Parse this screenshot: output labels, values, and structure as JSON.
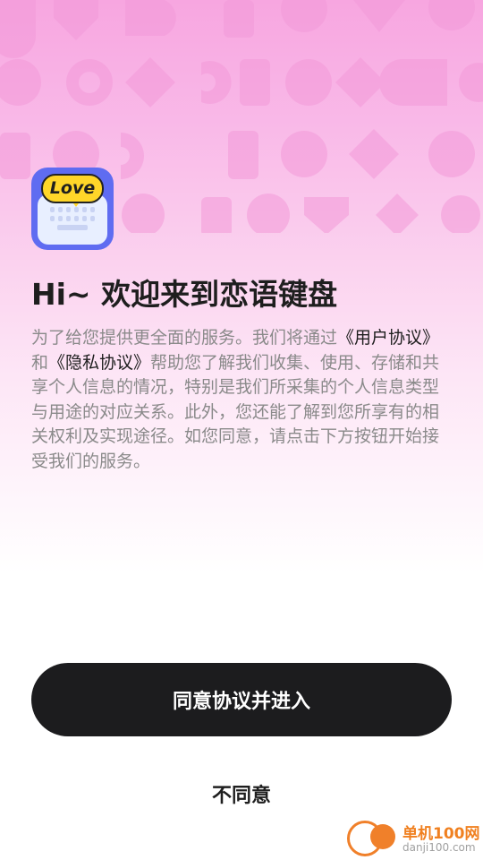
{
  "app_icon": {
    "bubble_text": "Love"
  },
  "title": "Hi~ 欢迎来到恋语键盘",
  "description": {
    "part1": "为了给您提供更全面的服务。我们将通过",
    "user_agreement": "《用户协议》",
    "and": "和",
    "privacy_agreement": "《隐私协议》",
    "part2": "帮助您了解我们收集、使用、存储和共享个人信息的情况，特别是我们所采集的个人信息类型与用途的对应关系。此外，您还能了解到您所享有的相关权利及实现途径。如您同意，请点击下方按钮开始接受我们的服务。"
  },
  "buttons": {
    "agree": "同意协议并进入",
    "disagree": "不同意"
  },
  "watermark": {
    "cn": "单机100网",
    "en": "danji100.com"
  },
  "colors": {
    "primary_button": "#1c1c1e",
    "icon_background": "#5f6cf1",
    "bubble": "#ffd629",
    "pattern": "#f39ad9"
  }
}
